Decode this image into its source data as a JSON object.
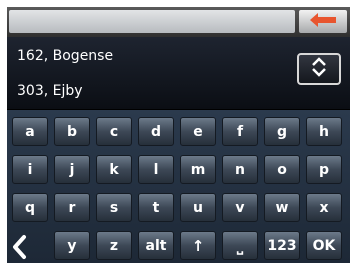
{
  "search": {
    "value": "",
    "placeholder": ""
  },
  "results": [
    {
      "number": "162",
      "separator": ", ",
      "name": "Bogense"
    },
    {
      "number": "303",
      "separator": ", ",
      "name": "Ejby"
    }
  ],
  "keyboard": {
    "row1": [
      "a",
      "b",
      "c",
      "d",
      "e",
      "f",
      "g",
      "h"
    ],
    "row2": [
      "i",
      "j",
      "k",
      "l",
      "m",
      "n",
      "o",
      "p"
    ],
    "row3": [
      "q",
      "r",
      "s",
      "t",
      "u",
      "v",
      "w",
      "x"
    ],
    "row4": [
      "y",
      "z",
      "alt",
      "↑",
      "⎵",
      "123",
      "OK"
    ]
  },
  "colors": {
    "accent": "#e8552e",
    "panel": "#0b0e14",
    "keyboard": "#24303f"
  },
  "icons": {
    "backspace": "backspace-arrow-icon",
    "scroll": "up-down-chevron-icon",
    "back": "back-chevron-icon"
  }
}
